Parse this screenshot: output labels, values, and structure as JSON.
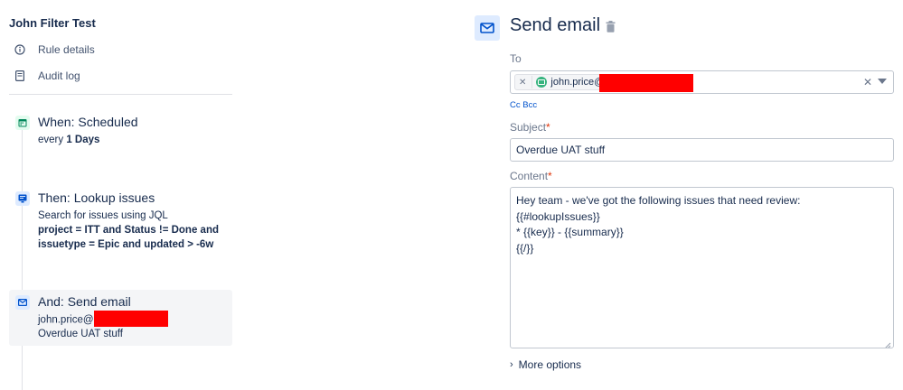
{
  "sidebar": {
    "title": "John Filter Test",
    "nav": [
      {
        "label": "Rule details",
        "icon": "info-icon"
      },
      {
        "label": "Audit log",
        "icon": "document-icon"
      }
    ],
    "steps": {
      "when": {
        "title": "When: Scheduled",
        "line_prefix": "every ",
        "line_bold": "1 Days",
        "icon": "calendar-icon"
      },
      "then": {
        "title": "Then: Lookup issues",
        "line1": "Search for issues using JQL",
        "line2": "project = ITT and Status != Done and",
        "line3": "issuetype = Epic and updated > -6w",
        "icon": "lookup-icon"
      },
      "and": {
        "title": "And: Send email",
        "recipient": "john.price@",
        "subject": "Overdue UAT stuff",
        "icon": "mail-icon"
      }
    }
  },
  "panel": {
    "title": "Send email",
    "icon": "mail-icon",
    "to": {
      "label": "To",
      "recipient_chip": "john.price@"
    },
    "cc_bcc": "Cc Bcc",
    "subject": {
      "label": "Subject",
      "required_mark": "*",
      "value": "Overdue UAT stuff"
    },
    "content": {
      "label": "Content",
      "required_mark": "*",
      "value": "Hey team - we've got the following issues that need review:\n{{#lookupIssues}}\n* {{key}} - {{summary}}\n{{/}}"
    },
    "more_options": "More options"
  },
  "colors": {
    "accent": "#0052cc",
    "redaction": "#ff0000",
    "step_active_bg": "#f4f5f7"
  }
}
